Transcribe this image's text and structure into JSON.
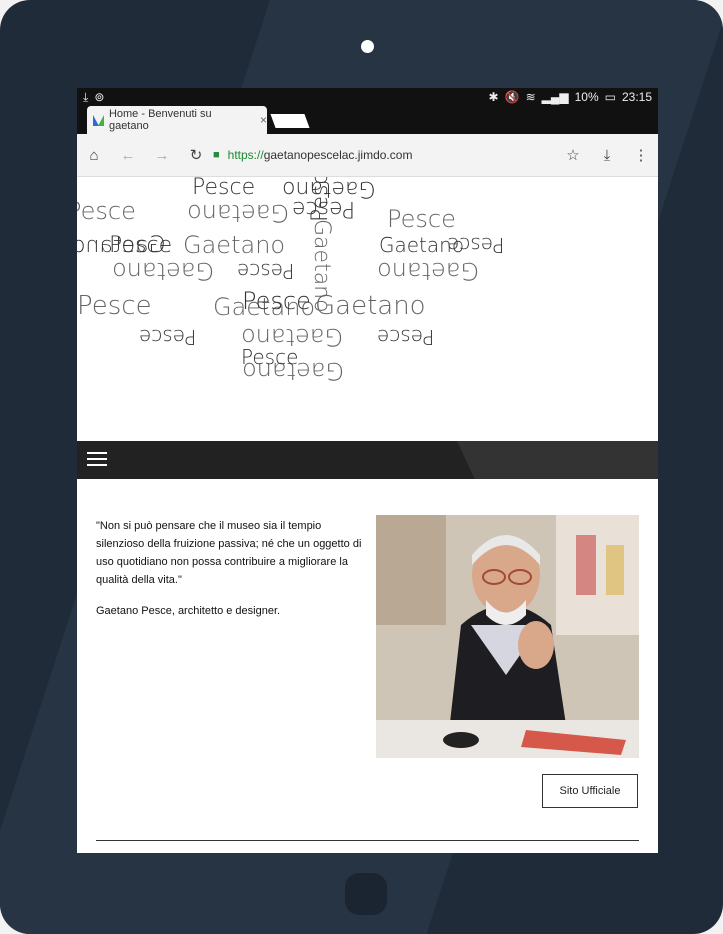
{
  "status_bar": {
    "left_icons": [
      "download-icon",
      "sync-icon"
    ],
    "battery": "10%",
    "time": "23:15"
  },
  "browser": {
    "tab_title": "Home - Benvenuti su gaetano",
    "tab_close": "×",
    "url_proto": "https://",
    "url_host": "gaetanopescelac.jimdo.com",
    "nav": {
      "home": "⌂",
      "back": "←",
      "forward": "→",
      "reload": "↻",
      "star": "☆",
      "download": "⤓",
      "menu": "⋮"
    }
  },
  "hero": {
    "words": [
      "Pesce",
      "Gaetano",
      "Pesce",
      "Gaetano",
      "Pesce",
      "Gaetano",
      "Pesce",
      "Gaetano",
      "Pesce",
      "Gaetano",
      "Pesce",
      "Gaetano",
      "Pesce",
      "Gaetano",
      "Pesce",
      "Gaetano",
      "Pesce",
      "Gaetano",
      "Pesce",
      "Gaetano",
      "Pesce",
      "Pesce",
      "Gaetano",
      "Gaetano",
      "Pesce"
    ]
  },
  "content": {
    "quote": "\"Non si può pensare che il museo sia il tempio silenzioso della fruizione passiva; né che un oggetto di uso quotidiano non possa contribuire a migliorare la qualità della vita.\"",
    "author": "Gaetano Pesce, architetto e designer.",
    "button_label": "Sito Ufficiale"
  },
  "colors": {
    "tablet": "#1f2b38",
    "navbar": "#222222",
    "url_secure": "#1a8a2e"
  }
}
